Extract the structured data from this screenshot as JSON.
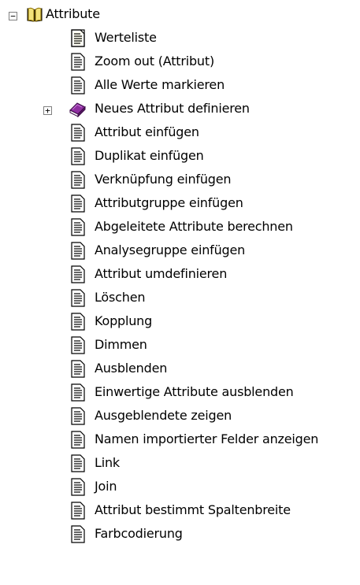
{
  "tree": {
    "root": {
      "label": "Attribute",
      "expander": "−",
      "icon": "open-book-icon"
    },
    "children": [
      {
        "label": "Werteliste",
        "icon": "document-icon"
      },
      {
        "label": "Zoom out (Attribut)",
        "icon": "document-icon"
      },
      {
        "label": "Alle Werte markieren",
        "icon": "document-icon"
      },
      {
        "label": "Neues Attribut definieren",
        "icon": "closed-book-icon",
        "expander": "+"
      },
      {
        "label": "Attribut einfügen",
        "icon": "document-icon"
      },
      {
        "label": "Duplikat einfügen",
        "icon": "document-icon"
      },
      {
        "label": "Verknüpfung einfügen",
        "icon": "document-icon"
      },
      {
        "label": "Attributgruppe einfügen",
        "icon": "document-icon"
      },
      {
        "label": "Abgeleitete Attribute berechnen",
        "icon": "document-icon"
      },
      {
        "label": "Analysegruppe einfügen",
        "icon": "document-icon"
      },
      {
        "label": "Attribut umdefinieren",
        "icon": "document-icon"
      },
      {
        "label": "Löschen",
        "icon": "document-icon"
      },
      {
        "label": "Kopplung",
        "icon": "document-icon"
      },
      {
        "label": "Dimmen",
        "icon": "document-icon"
      },
      {
        "label": "Ausblenden",
        "icon": "document-icon"
      },
      {
        "label": "Einwertige Attribute ausblenden",
        "icon": "document-icon"
      },
      {
        "label": "Ausgeblendete zeigen",
        "icon": "document-icon"
      },
      {
        "label": "Namen importierter Felder anzeigen",
        "icon": "document-icon"
      },
      {
        "label": "Link",
        "icon": "document-icon"
      },
      {
        "label": "Join",
        "icon": "document-icon"
      },
      {
        "label": "Attribut bestimmt Spaltenbreite",
        "icon": "document-icon"
      },
      {
        "label": "Farbcodierung",
        "icon": "document-icon"
      }
    ]
  }
}
